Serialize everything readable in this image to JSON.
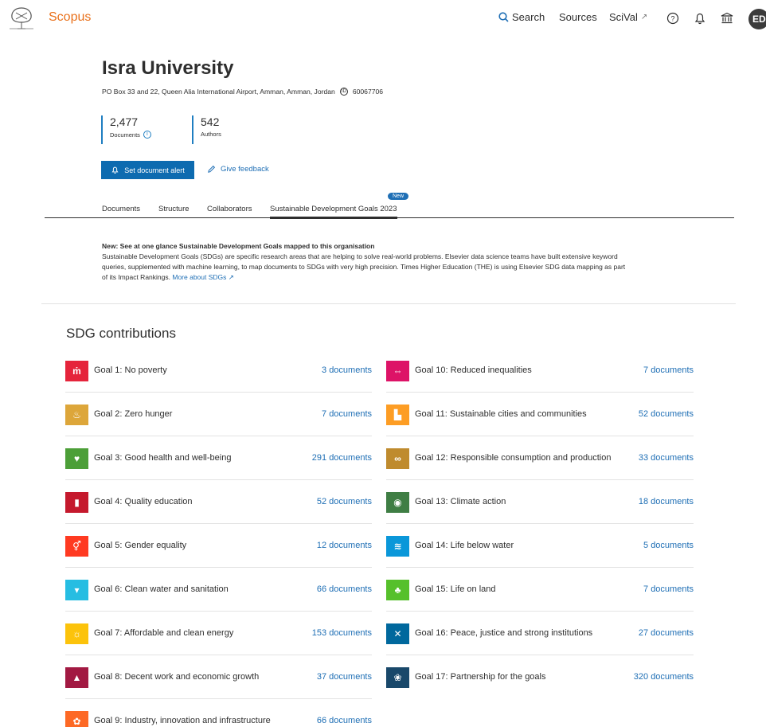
{
  "header": {
    "brand": "Scopus",
    "nav": {
      "search_label": "Search",
      "sources_label": "Sources",
      "scival_label": "SciVal",
      "scival_ext": "↗"
    },
    "avatar_initials": "ED",
    "icons": [
      "elsevier-logo",
      "search-icon",
      "help-icon",
      "bell-icon",
      "institution-icon"
    ]
  },
  "institution": {
    "name": "Isra University",
    "address": "PO Box 33 and 22, Queen Alia International Airport, Amman, Amman, Jordan",
    "id": "60067706",
    "metrics": [
      {
        "value": "2,477",
        "label": "Documents"
      },
      {
        "value": "542",
        "label": "Authors"
      }
    ],
    "alert_button": "Set document alert",
    "feedback_link": "Give feedback"
  },
  "tabs": {
    "items": [
      "Documents",
      "Structure",
      "Collaborators",
      "Sustainable Development Goals 2023"
    ],
    "active": "Sustainable Development Goals 2023",
    "new_badge": "New"
  },
  "notice": {
    "heading": "New: See at one glance Sustainable Development Goals mapped to this organisation",
    "body": "Sustainable Development Goals (SDGs) are specific research areas that are helping to solve real-world problems. Elsevier data science teams have built extensive keyword queries, supplemented with machine learning, to map documents to SDGs with very high precision. Times Higher Education (THE) is using Elsevier SDG data mapping as part of its Impact Rankings.",
    "link": "More about SDGs ↗"
  },
  "sdg": {
    "title": "SDG contributions",
    "left": [
      {
        "label": "Goal 1: No poverty",
        "count": "3 documents",
        "color": "#e5243b",
        "glyph": "ṁ"
      },
      {
        "label": "Goal 2: Zero hunger",
        "count": "7 documents",
        "color": "#dda63a",
        "glyph": "♨"
      },
      {
        "label": "Goal 3: Good health and well-being",
        "count": "291 documents",
        "color": "#4c9f38",
        "glyph": "♥"
      },
      {
        "label": "Goal 4: Quality education",
        "count": "52 documents",
        "color": "#c5192d",
        "glyph": "▮"
      },
      {
        "label": "Goal 5: Gender equality",
        "count": "12 documents",
        "color": "#ff3a21",
        "glyph": "⚥"
      },
      {
        "label": "Goal 6: Clean water and sanitation",
        "count": "66 documents",
        "color": "#26bde2",
        "glyph": "▾"
      },
      {
        "label": "Goal 7: Affordable and clean energy",
        "count": "153 documents",
        "color": "#fcc30b",
        "glyph": "☼"
      },
      {
        "label": "Goal 8: Decent work and economic growth",
        "count": "37 documents",
        "color": "#a21942",
        "glyph": "▲"
      },
      {
        "label": "Goal 9: Industry, innovation and infrastructure",
        "count": "66 documents",
        "color": "#fd6925",
        "glyph": "✿"
      }
    ],
    "right": [
      {
        "label": "Goal 10: Reduced inequalities",
        "count": "7 documents",
        "color": "#dd1367",
        "glyph": "⇔"
      },
      {
        "label": "Goal 11: Sustainable cities and communities",
        "count": "52 documents",
        "color": "#fd9d24",
        "glyph": "▙"
      },
      {
        "label": "Goal 12: Responsible consumption and production",
        "count": "33 documents",
        "color": "#bf8b2e",
        "glyph": "∞"
      },
      {
        "label": "Goal 13: Climate action",
        "count": "18 documents",
        "color": "#3f7e44",
        "glyph": "◉"
      },
      {
        "label": "Goal 14: Life below water",
        "count": "5 documents",
        "color": "#0a97d9",
        "glyph": "≋"
      },
      {
        "label": "Goal 15: Life on land",
        "count": "7 documents",
        "color": "#56c02b",
        "glyph": "♣"
      },
      {
        "label": "Goal 16: Peace, justice and strong institutions",
        "count": "27 documents",
        "color": "#00689d",
        "glyph": "✕"
      },
      {
        "label": "Goal 17: Partnership for the goals",
        "count": "320 documents",
        "color": "#19486a",
        "glyph": "❀"
      }
    ]
  }
}
